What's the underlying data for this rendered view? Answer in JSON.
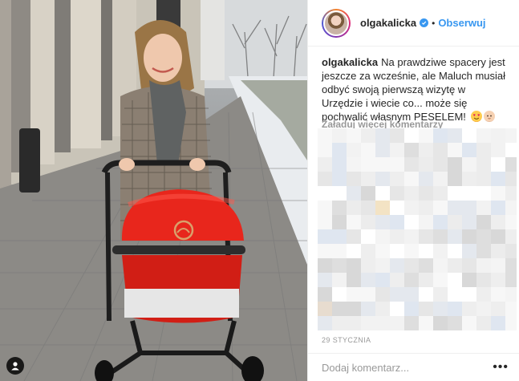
{
  "post": {
    "username": "olgakalicka",
    "separator": "•",
    "follow_label": "Obserwuj",
    "caption_user": "olgakalicka",
    "caption_text": "Na prawdziwe spacery jest jeszcze za wcześnie, ale Maluch musiał odbyć swoją pierwszą wizytę w Urzędzie i wiecie co... może się pochwalić własnym PESELEM!",
    "caption_emojis": [
      "smiling-face-with-heart-eyes",
      "baby-face"
    ],
    "load_more_label": "Załaduj więcej komentarzy",
    "date": "29 STYCZNIA",
    "comment_placeholder": "Dodaj komentarz...",
    "more_label": "•••"
  },
  "colors": {
    "accent": "#3897f0",
    "stroller_canopy": "#e8261c",
    "muted_text": "#999999"
  },
  "icons": {
    "verified": "verified-badge-icon",
    "user_tag": "user-tag-icon",
    "more": "more-options-icon"
  }
}
